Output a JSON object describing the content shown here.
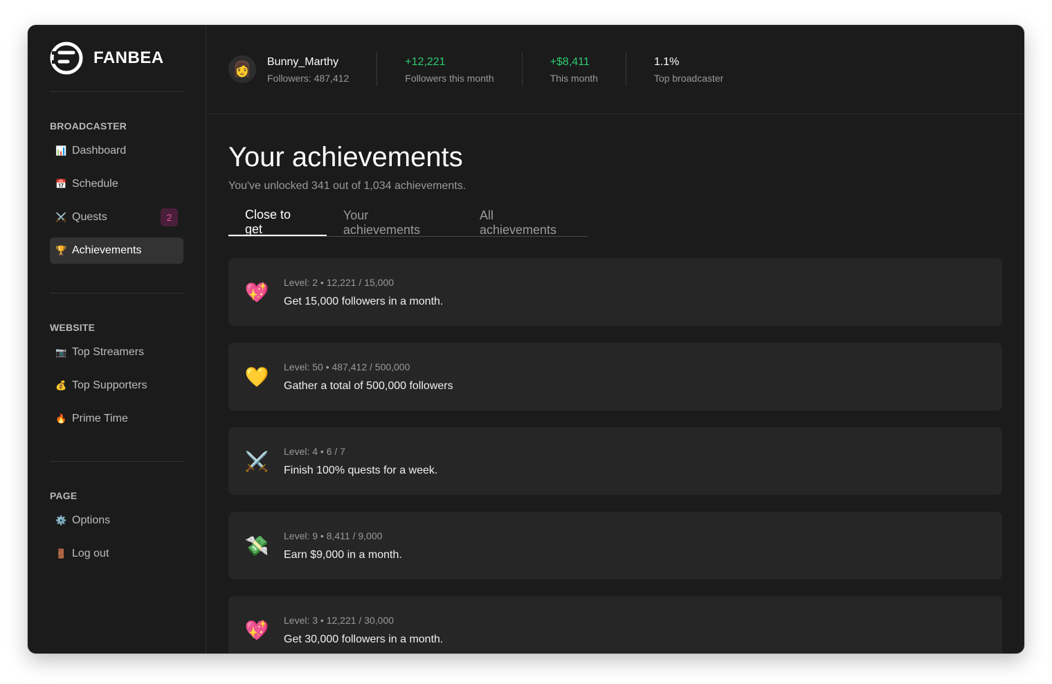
{
  "brand": {
    "name": "FANBEA"
  },
  "sidebar": {
    "sections": [
      {
        "title": "BROADCASTER",
        "items": [
          {
            "icon": "📊",
            "label": "Dashboard"
          },
          {
            "icon": "📅",
            "label": "Schedule"
          },
          {
            "icon": "⚔️",
            "label": "Quests",
            "badge": "2"
          },
          {
            "icon": "🏆",
            "label": "Achievements",
            "active": true
          }
        ]
      },
      {
        "title": "WEBSITE",
        "items": [
          {
            "icon": "📷",
            "label": "Top Streamers"
          },
          {
            "icon": "💰",
            "label": "Top Supporters"
          },
          {
            "icon": "🔥",
            "label": "Prime Time"
          }
        ]
      },
      {
        "title": "PAGE",
        "items": [
          {
            "icon": "⚙️",
            "label": "Options"
          },
          {
            "icon": "🚪",
            "label": "Log out"
          }
        ]
      }
    ]
  },
  "topbar": {
    "avatar_icon": "👩",
    "username": "Bunny_Marthy",
    "followers": "Followers: 487,412",
    "stats": [
      {
        "value": "+12,221",
        "label": "Followers this month",
        "color": "#2ecc71"
      },
      {
        "value": "+$8,411",
        "label": "This month",
        "color": "#2ecc71"
      },
      {
        "value": "1.1%",
        "label": "Top broadcaster",
        "color": "#ffffff"
      }
    ]
  },
  "page": {
    "title": "Your achievements",
    "subtitle": "You've unlocked 341 out of 1,034 achievements."
  },
  "tabs": [
    {
      "label": "Close to get",
      "active": true
    },
    {
      "label": "Your achievements"
    },
    {
      "label": "All achievements"
    }
  ],
  "achievements": [
    {
      "icon": "💖",
      "meta": "Level: 2 • 12,221 / 15,000",
      "desc": "Get 15,000 followers in a month."
    },
    {
      "icon": "💛",
      "meta": "Level: 50 • 487,412 / 500,000",
      "desc": "Gather a total of 500,000 followers"
    },
    {
      "icon": "⚔️",
      "meta": "Level: 4 • 6 / 7",
      "desc": "Finish 100% quests for a week."
    },
    {
      "icon": "💸",
      "meta": "Level: 9 • 8,411 / 9,000",
      "desc": "Earn $9,000 in a month."
    },
    {
      "icon": "💖",
      "meta": "Level: 3 • 12,221 / 30,000",
      "desc": "Get 30,000 followers in a month."
    }
  ]
}
